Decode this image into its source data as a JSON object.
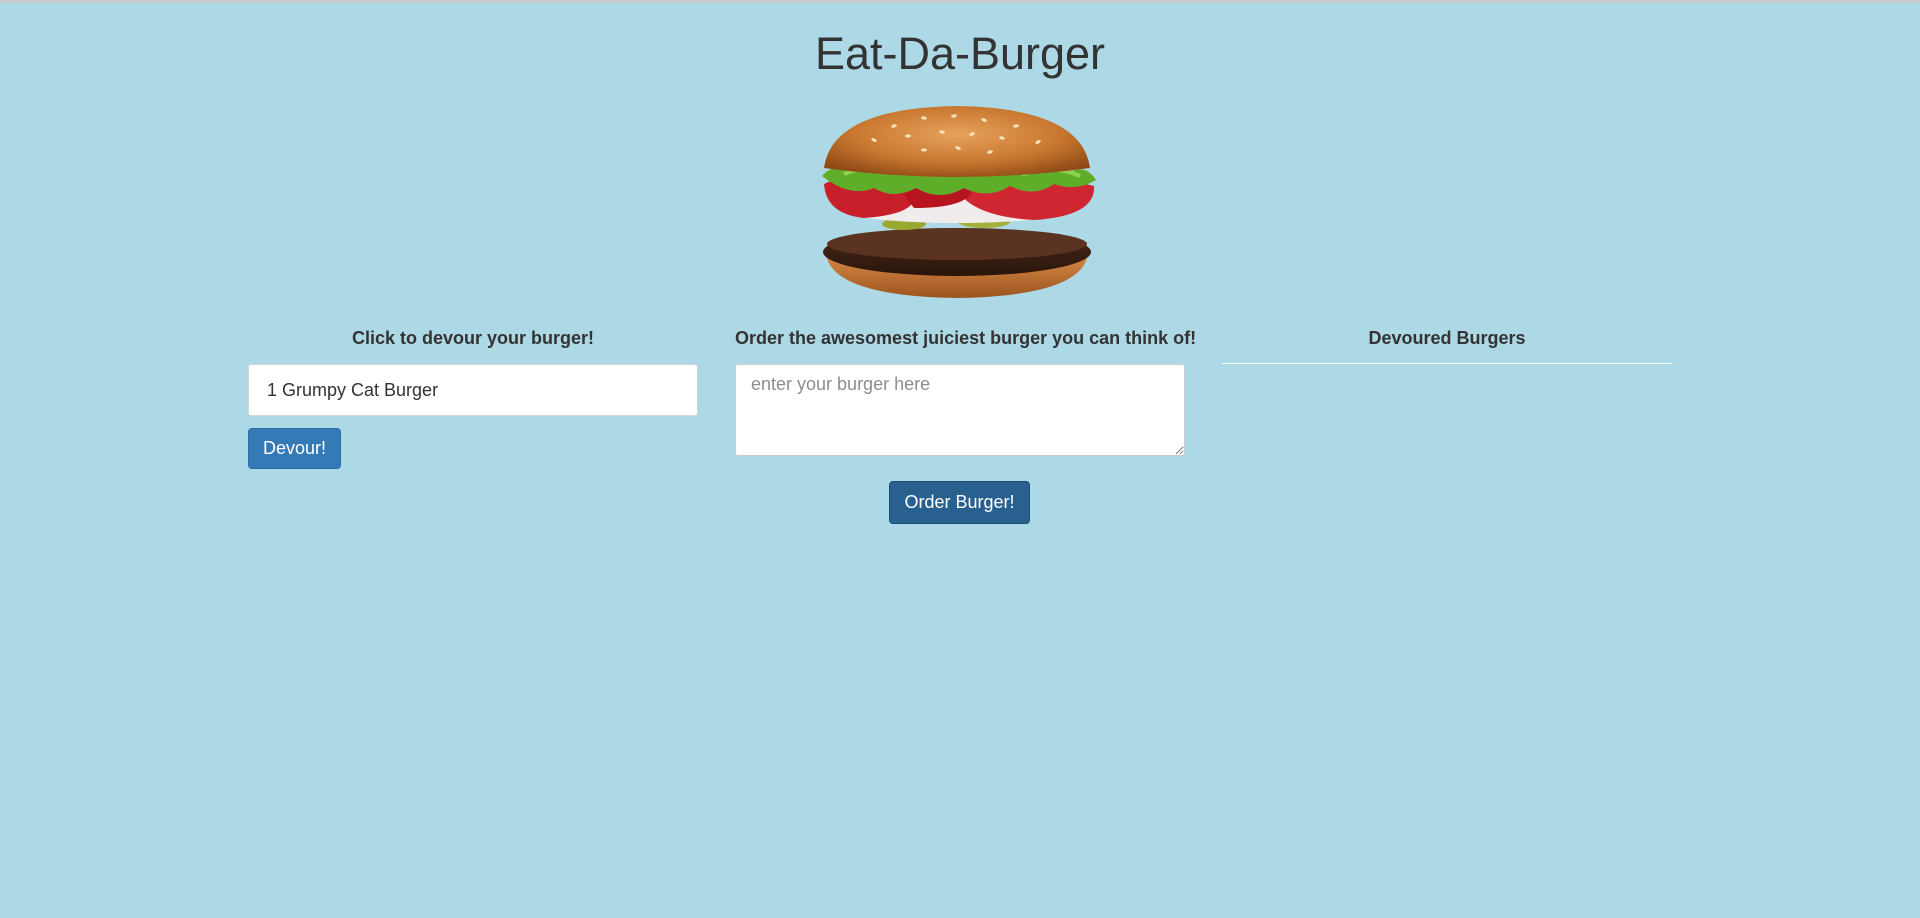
{
  "page": {
    "title": "Eat-Da-Burger",
    "background_color": "#add8e6"
  },
  "hero": {
    "image": "burger-photo"
  },
  "devour_column": {
    "heading": "Click to devour your burger!",
    "burgers": [
      {
        "label": "1 Grumpy Cat Burger"
      }
    ],
    "button_label": "Devour!"
  },
  "order_column": {
    "heading": "Order the awesomest juiciest burger you can think of!",
    "input_value": "",
    "placeholder": "enter your burger here",
    "button_label": "Order Burger!"
  },
  "devoured_column": {
    "heading": "Devoured Burgers",
    "items": []
  },
  "colors": {
    "accent": "#337ab7",
    "accent_dark": "#286090"
  }
}
